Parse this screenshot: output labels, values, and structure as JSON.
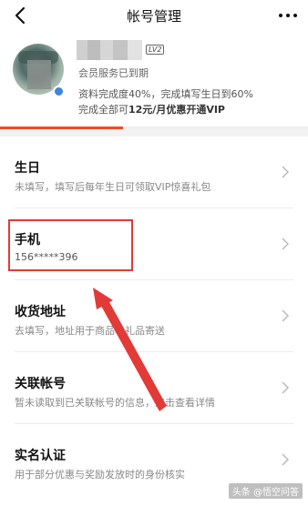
{
  "nav": {
    "title": "帐号管理"
  },
  "profile": {
    "lv_badge": "LV2",
    "vip_status": "会员服务已到期",
    "completion_line": "资料完成度40%，完成填写生日到60%",
    "offer_prefix": "完成全部可",
    "offer_price": "12元/月优惠开通VIP",
    "completion_progress": 0.4
  },
  "items": [
    {
      "title": "生日",
      "subtitle": "未填写，填写后每年生日可领取VIP惊喜礼包"
    },
    {
      "title": "手机",
      "subtitle": "156*****396"
    },
    {
      "title": "收货地址",
      "subtitle": "去填写，地址用于商品与礼品寄送"
    },
    {
      "title": "关联帐号",
      "subtitle": "暂未读取到已关联帐号的信息，点击查看详情"
    },
    {
      "title": "实名认证",
      "subtitle": "用于部分优惠与奖励发放时的身份核实"
    }
  ],
  "watermark": "头条 @悟空问答",
  "colors": {
    "accent": "#f04a2a",
    "annotation": "#e23a36",
    "badge_blue": "#3f86d8"
  }
}
